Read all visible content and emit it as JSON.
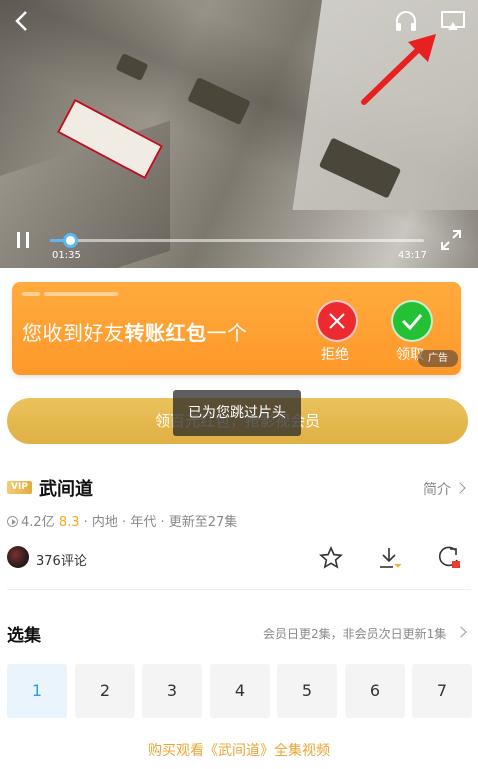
{
  "player": {
    "current_time": "01:35",
    "duration": "43:17",
    "progress": 0.053,
    "icons": {
      "back": "back-arrow-icon",
      "headphones": "headphones-icon",
      "cast": "cast-screen-icon",
      "pause": "pause-icon",
      "fullscreen": "fullscreen-icon"
    }
  },
  "ad": {
    "text_prefix": "您收到好友",
    "text_bold": "转账红包",
    "text_suffix": "一个",
    "reject_label": "拒绝",
    "accept_label": "领取",
    "tag": "广告"
  },
  "banner": {
    "gold_text": "领百元红包，抢影视会员",
    "toast": "已为您跳过片头"
  },
  "show": {
    "vip_badge": "VIP",
    "title": "武间道",
    "intro_label": "简介",
    "views": "4.2亿",
    "score": "8.3",
    "meta_rest": "· 内地 · 年代 · 更新至27集",
    "comments": "376评论",
    "actions": [
      "star-icon",
      "download-icon",
      "share-icon"
    ]
  },
  "episodes": {
    "title": "选集",
    "update_note": "会员日更2集，非会员次日更新1集",
    "list": [
      "1",
      "2",
      "3",
      "4",
      "5",
      "6",
      "7"
    ],
    "active_index": 0,
    "buy_text": "购买观看《武间道》全集视频"
  },
  "colors": {
    "accent_blue": "#5ab9f5",
    "ad_orange": "#ff9f33",
    "gold": "#e6b94f",
    "score": "#f5a623"
  }
}
